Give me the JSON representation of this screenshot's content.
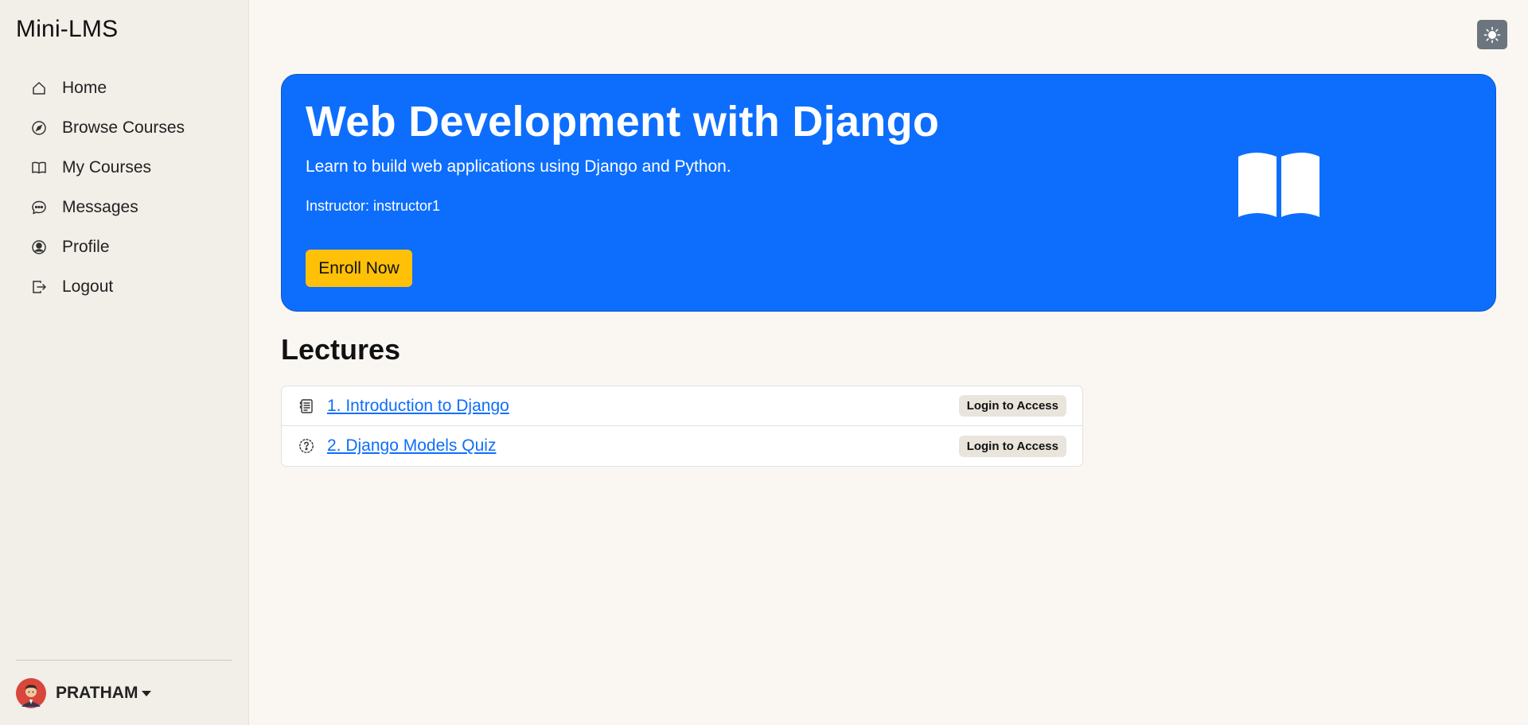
{
  "sidebar": {
    "brand": "Mini-LMS",
    "items": [
      {
        "label": "Home",
        "icon": "home-icon"
      },
      {
        "label": "Browse Courses",
        "icon": "compass-icon"
      },
      {
        "label": "My Courses",
        "icon": "book-icon"
      },
      {
        "label": "Messages",
        "icon": "chat-icon"
      },
      {
        "label": "Profile",
        "icon": "person-circle-icon"
      },
      {
        "label": "Logout",
        "icon": "logout-icon"
      }
    ],
    "user": {
      "name": "PRATHAM"
    }
  },
  "header": {
    "theme_toggle_icon": "sun-icon"
  },
  "course": {
    "title": "Web Development with Django",
    "description": "Learn to build web applications using Django and Python.",
    "instructor": "Instructor: instructor1",
    "enroll_label": "Enroll Now",
    "hero_icon": "open-book-icon"
  },
  "lectures": {
    "heading": "Lectures",
    "items": [
      {
        "title": "1. Introduction to Django",
        "icon": "document-icon",
        "badge": "Login to Access"
      },
      {
        "title": "2. Django Models Quiz",
        "icon": "question-circle-icon",
        "badge": "Login to Access"
      }
    ]
  },
  "colors": {
    "primary": "#0d6efd",
    "warning": "#ffc107",
    "background": "#faf7f2",
    "sidebar": "#f2eee8"
  }
}
